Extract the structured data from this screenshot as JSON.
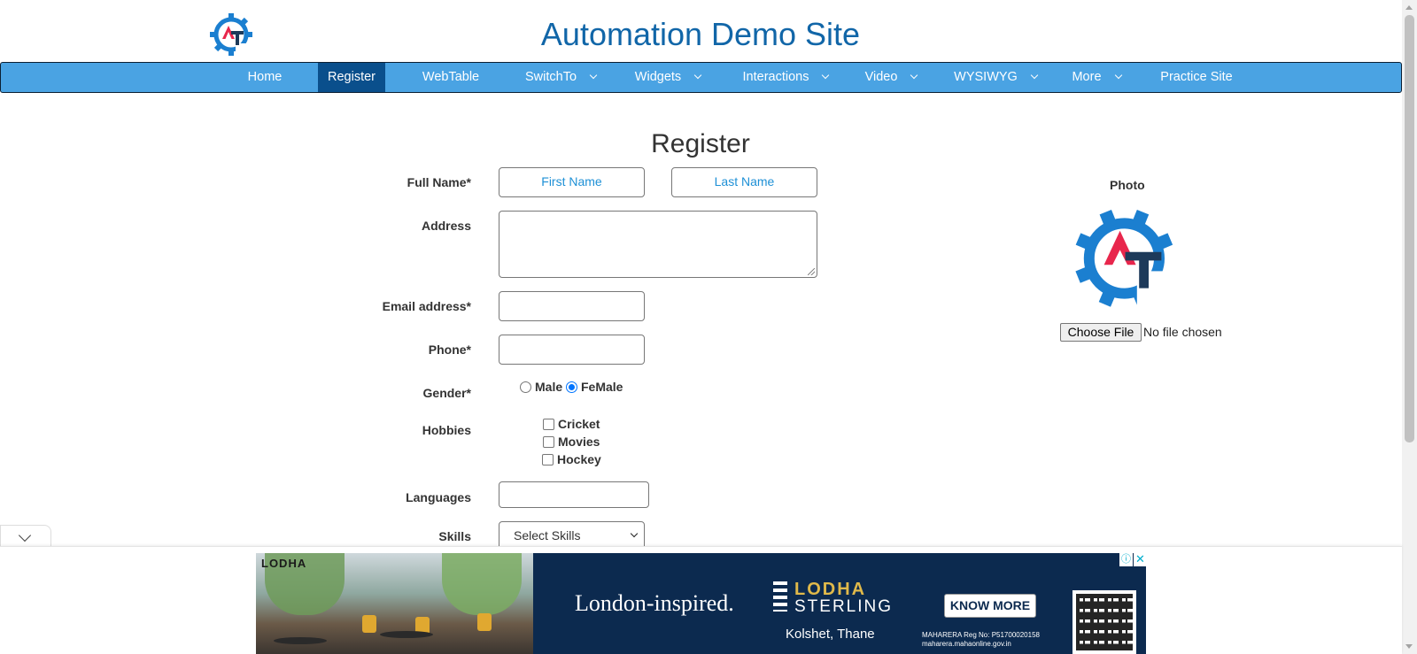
{
  "header": {
    "title": "Automation Demo Site"
  },
  "nav": {
    "items": [
      {
        "label": "Home"
      },
      {
        "label": "Register"
      },
      {
        "label": "WebTable"
      },
      {
        "label": "SwitchTo"
      },
      {
        "label": "Widgets"
      },
      {
        "label": "Interactions"
      },
      {
        "label": "Video"
      },
      {
        "label": "WYSIWYG"
      },
      {
        "label": "More"
      },
      {
        "label": "Practice Site"
      }
    ],
    "active": "Register"
  },
  "form": {
    "title": "Register",
    "full_name_label": "Full Name*",
    "first_name_placeholder": "First Name",
    "last_name_placeholder": "Last Name",
    "address_label": "Address",
    "email_label": "Email address*",
    "phone_label": "Phone*",
    "gender_label": "Gender*",
    "gender_options": [
      {
        "label": "Male",
        "checked": false
      },
      {
        "label": "FeMale",
        "checked": true
      }
    ],
    "hobbies_label": "Hobbies",
    "hobbies": [
      {
        "label": "Cricket",
        "checked": false
      },
      {
        "label": "Movies",
        "checked": false
      },
      {
        "label": "Hockey",
        "checked": false
      }
    ],
    "languages_label": "Languages",
    "skills_label": "Skills",
    "skills_selected": "Select Skills"
  },
  "photo": {
    "label": "Photo",
    "choose_button": "Choose File",
    "file_status": "No file chosen"
  },
  "ad": {
    "brand_tag": "LODHA",
    "tagline": "London-inspired.",
    "brand_line1": "LODHA",
    "brand_line2": "STERLING",
    "location": "Kolshet, Thane",
    "cta": "KNOW MORE",
    "rera_line1": "MAHARERA Reg No: P51700020158",
    "rera_line2": "maharera.mahaonline.gov.in",
    "info_icon": "ⓘ",
    "close_icon": "✕"
  },
  "colors": {
    "nav_bg": "#4aa3e3",
    "nav_active": "#0a4f8c",
    "title": "#1166a8",
    "placeholder": "#1e90d6",
    "logo_blue": "#1b7fd0",
    "logo_red": "#e8264c",
    "logo_dark": "#1d3a5a"
  }
}
